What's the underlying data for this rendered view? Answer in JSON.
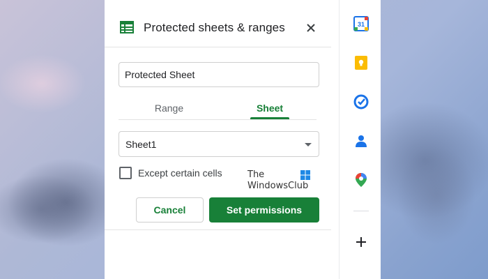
{
  "panel": {
    "title": "Protected sheets & ranges",
    "description_value": "Protected Sheet",
    "tabs": [
      {
        "label": "Range",
        "active": false
      },
      {
        "label": "Sheet",
        "active": true
      }
    ],
    "sheet_select": {
      "value": "Sheet1"
    },
    "except_cells": {
      "label": "Except certain cells",
      "checked": false
    },
    "buttons": {
      "cancel": "Cancel",
      "set_permissions": "Set permissions"
    }
  },
  "watermark": {
    "line1": "The",
    "line2": "WindowsClub"
  },
  "side_panel": {
    "icons": [
      "calendar-icon",
      "keep-icon",
      "tasks-icon",
      "contacts-icon",
      "maps-icon"
    ],
    "calendar_day": "31"
  },
  "colors": {
    "accent": "#188038",
    "calendar_blue": "#1a73e8",
    "keep_yellow": "#fbbc04",
    "maps_red": "#ea4335"
  }
}
